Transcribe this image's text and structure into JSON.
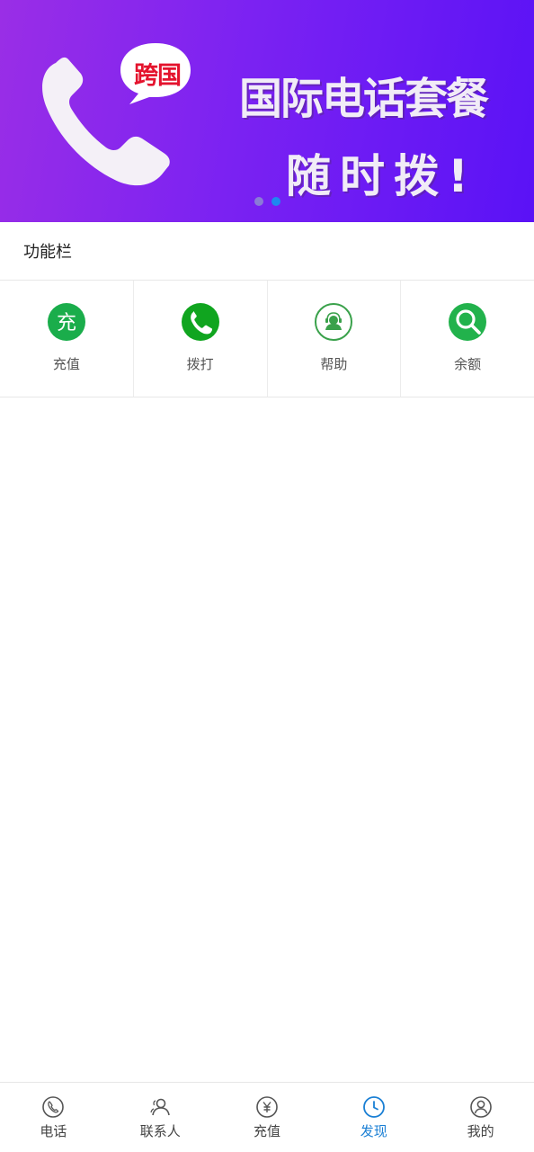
{
  "banner": {
    "bubble_text": "跨国",
    "title": "国际电话套餐",
    "subtitle": "随时拨!",
    "slide_count": 2,
    "active_slide": 2
  },
  "section": {
    "title": "功能栏"
  },
  "functions": [
    {
      "label": "充值",
      "icon": "recharge-icon",
      "icon_char": "充"
    },
    {
      "label": "拨打",
      "icon": "phone-call-icon"
    },
    {
      "label": "帮助",
      "icon": "customer-service-icon"
    },
    {
      "label": "余额",
      "icon": "search-icon"
    }
  ],
  "tabbar": {
    "items": [
      {
        "label": "电话",
        "icon": "phone-icon"
      },
      {
        "label": "联系人",
        "icon": "contacts-icon"
      },
      {
        "label": "充值",
        "icon": "yen-coin-icon"
      },
      {
        "label": "发现",
        "icon": "clock-icon"
      },
      {
        "label": "我的",
        "icon": "user-icon"
      }
    ],
    "active": "发现"
  },
  "colors": {
    "accent": "#1a7fd4",
    "green": "#1aad4b",
    "banner_start": "#9a2ee6",
    "banner_end": "#5a12f6"
  }
}
